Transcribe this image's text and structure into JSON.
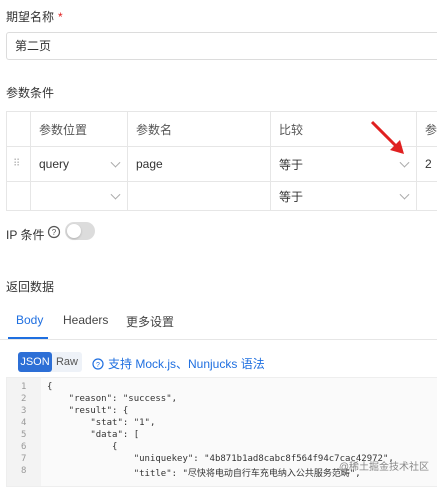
{
  "expected_name": {
    "label": "期望名称",
    "required_mark": "*",
    "value": "第二页"
  },
  "params_section": {
    "title": "参数条件",
    "headers": [
      "参数位置",
      "参数名",
      "比较",
      "参"
    ],
    "rows": [
      {
        "position": "query",
        "name": "page",
        "compare": "等于",
        "value": "2"
      },
      {
        "position": "",
        "name": "",
        "compare": "等于",
        "value": ""
      }
    ]
  },
  "ip_condition": {
    "label": "IP 条件",
    "help_icon": "question-circle-icon",
    "enabled": false
  },
  "return_data": {
    "title": "返回数据",
    "tabs": [
      {
        "label": "Body",
        "active": true
      },
      {
        "label": "Headers",
        "active": false
      },
      {
        "label": "更多设置",
        "active": false
      }
    ],
    "format_buttons": [
      {
        "label": "JSON",
        "active": true
      },
      {
        "label": "Raw",
        "active": false
      }
    ],
    "mock_link": "支持 Mock.js、Nunjucks 语法",
    "code_lines": [
      {
        "n": "1",
        "text": "{"
      },
      {
        "n": "2",
        "text": "    \"reason\": \"success\","
      },
      {
        "n": "3",
        "text": "    \"result\": {"
      },
      {
        "n": "4",
        "text": "        \"stat\": \"1\","
      },
      {
        "n": "5",
        "text": "        \"data\": ["
      },
      {
        "n": "6",
        "text": "            {"
      },
      {
        "n": "7",
        "text": "                \"uniquekey\": \"4b871b1ad8cabc8f564f94c7cac42972\","
      },
      {
        "n": "8",
        "text": "                \"title\": \"尽快将电动自行车充电纳入公共服务范畴\","
      }
    ]
  },
  "watermark": "@稀土掘金技术社区",
  "colors": {
    "accent": "#1f6fe0",
    "required": "#e02020",
    "annotation_arrow": "#e02020"
  }
}
